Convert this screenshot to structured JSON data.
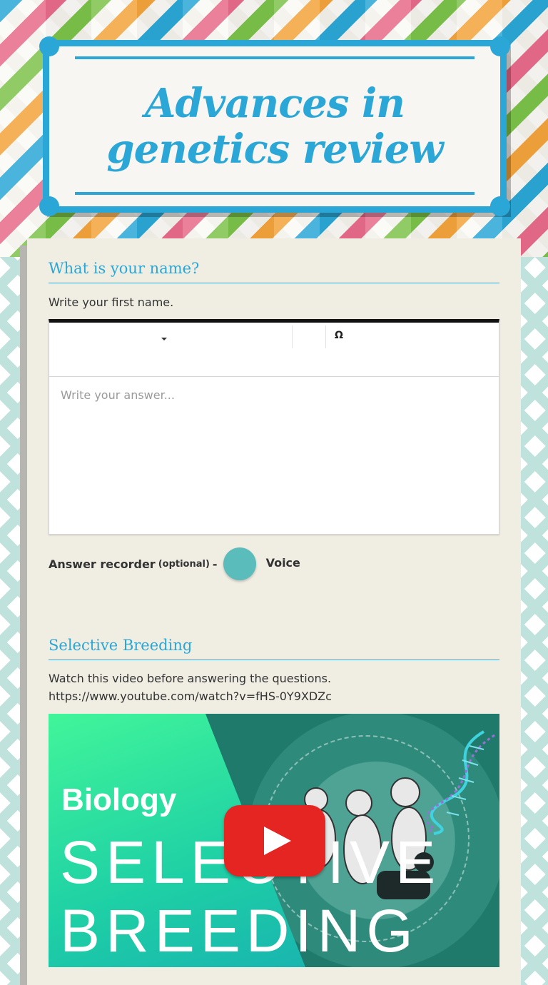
{
  "header": {
    "title": "Advances in genetics review"
  },
  "question1": {
    "title": "What is your name?",
    "instruction": "Write your first name.",
    "editor": {
      "toolbar_icons": [
        "caret-down-icon",
        "omega-icon"
      ],
      "omega_symbol": "Ω",
      "placeholder": "Write your answer..."
    },
    "recorder": {
      "label": "Answer recorder",
      "optional": "(optional)",
      "dash": "-",
      "voice_label": "Voice"
    }
  },
  "section2": {
    "title": "Selective Breeding",
    "instruction_line1": "Watch this video before answering the questions.",
    "instruction_line2": "https://www.youtube.com/watch?v=fHS-0Y9XDZc",
    "video": {
      "subject": "Biology",
      "title_line1": "SELECTIVE",
      "title_line2": "BREEDING",
      "play_icon": "play-button-icon"
    }
  },
  "colors": {
    "accent": "#2aa7d6",
    "voice_button": "#5bbcbc",
    "play_button": "#e52521"
  }
}
